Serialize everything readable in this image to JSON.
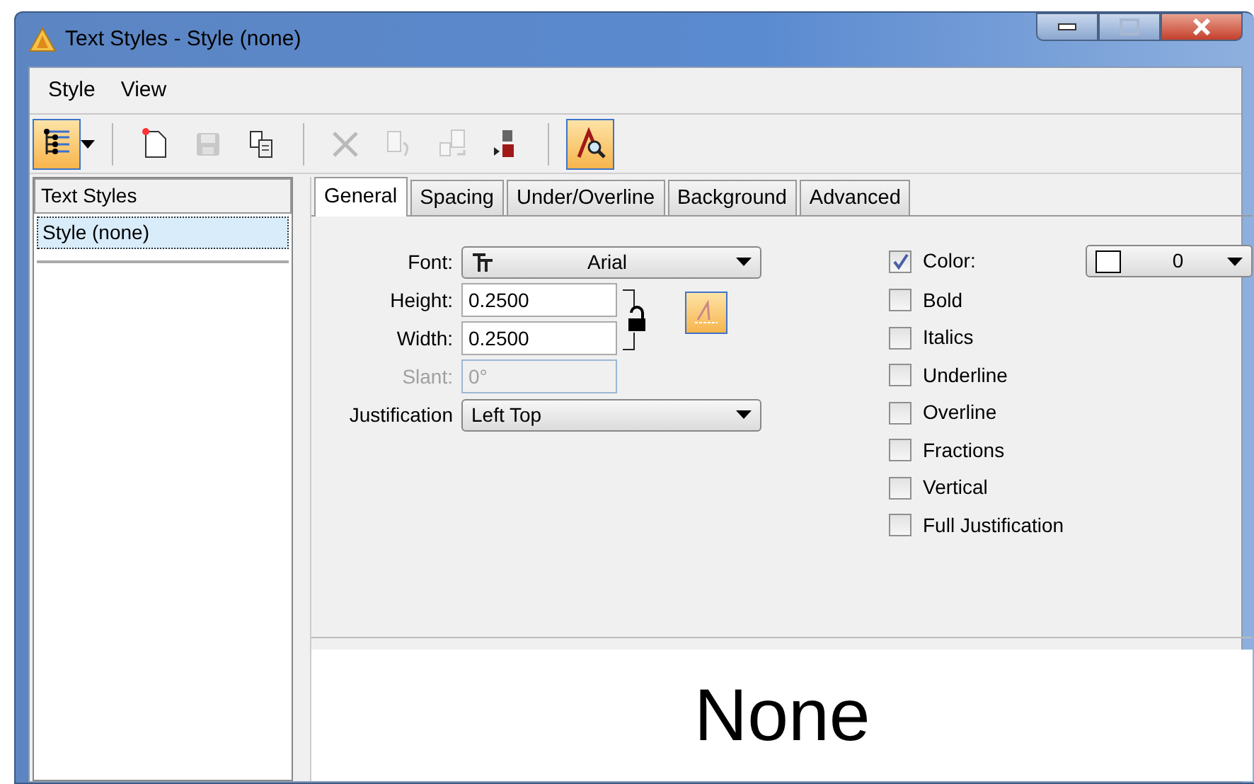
{
  "window": {
    "title": "Text Styles - Style (none)"
  },
  "menu": [
    "Style",
    "View"
  ],
  "toolbar": [
    {
      "kind": "tree",
      "selected": true,
      "disabled": false
    },
    {
      "kind": "new",
      "selected": false,
      "disabled": false
    },
    {
      "kind": "save",
      "selected": false,
      "disabled": true
    },
    {
      "kind": "copy",
      "selected": false,
      "disabled": false
    },
    {
      "kind": "delete",
      "selected": false,
      "disabled": true
    },
    {
      "kind": "undo",
      "selected": false,
      "disabled": true
    },
    {
      "kind": "redo",
      "selected": false,
      "disabled": true
    },
    {
      "kind": "transfer",
      "selected": false,
      "disabled": false
    },
    {
      "kind": "preview",
      "selected": true,
      "disabled": false
    }
  ],
  "list": {
    "header": "Text Styles",
    "items": [
      {
        "label": "Style (none)",
        "selected": true
      }
    ]
  },
  "tabs": [
    {
      "label": "General",
      "selected": true
    },
    {
      "label": "Spacing",
      "selected": false
    },
    {
      "label": "Under/Overline",
      "selected": false
    },
    {
      "label": "Background",
      "selected": false
    },
    {
      "label": "Advanced",
      "selected": false
    }
  ],
  "fields": [
    {
      "kind": "font",
      "label": "Font:",
      "value": "Arial",
      "disabled": false
    },
    {
      "kind": "input",
      "label": "Height:",
      "value": "0.2500",
      "disabled": false
    },
    {
      "kind": "input",
      "label": "Width:",
      "value": "0.2500",
      "disabled": false
    },
    {
      "kind": "input",
      "label": "Slant:",
      "value": "0°",
      "disabled": true
    },
    {
      "kind": "select",
      "label": "Justification",
      "value": "Left Top",
      "disabled": false
    }
  ],
  "checkboxes": [
    {
      "label": "Color:",
      "checked": true
    },
    {
      "label": "Bold",
      "checked": false
    },
    {
      "label": "Italics",
      "checked": false
    },
    {
      "label": "Underline",
      "checked": false
    },
    {
      "label": "Overline",
      "checked": false
    },
    {
      "label": "Fractions",
      "checked": false
    },
    {
      "label": "Vertical",
      "checked": false
    },
    {
      "label": "Full Justification",
      "checked": false
    }
  ],
  "color_select": {
    "value": "0"
  },
  "preview": {
    "text": "None"
  }
}
